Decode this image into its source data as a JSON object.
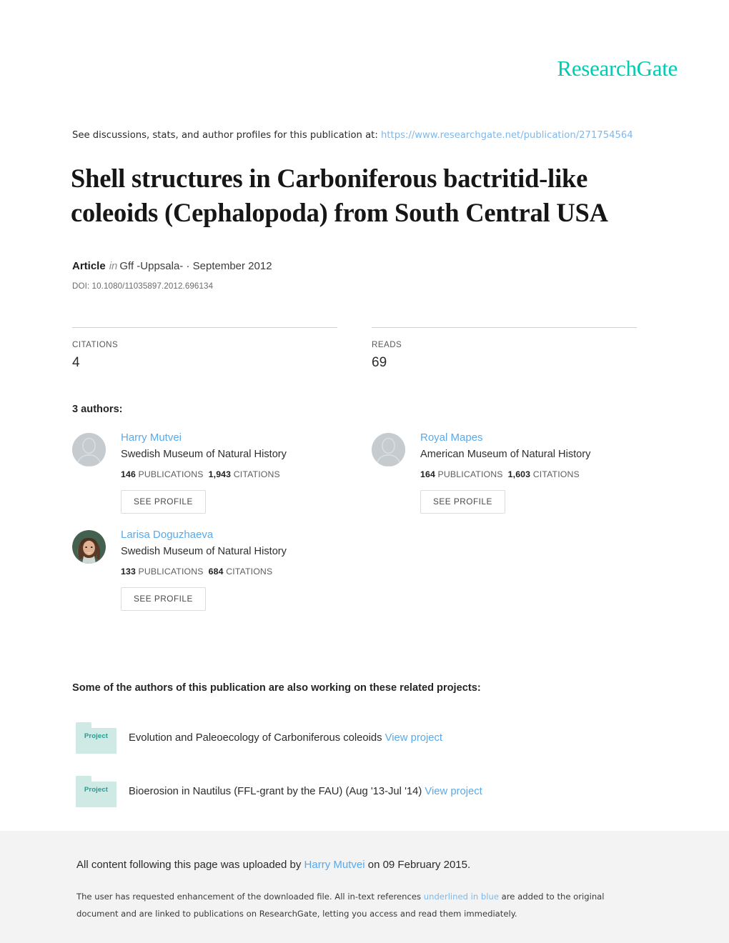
{
  "brand": {
    "logo_text": "ResearchGate",
    "logo_color": "#00ccb1"
  },
  "discussion": {
    "prefix": "See discussions, stats, and author profiles for this publication at: ",
    "url": "https://www.researchgate.net/publication/271754564",
    "link_color": "#7eb8ea"
  },
  "publication": {
    "title": "Shell structures in Carboniferous bactritid-like coleoids (Cephalopoda) from South Central USA",
    "type_label": "Article",
    "in_word": "in",
    "venue": "Gff -Uppsala- · September 2012",
    "doi": "DOI: 10.1080/11035897.2012.696134"
  },
  "stats": [
    {
      "label": "CITATIONS",
      "value": "4"
    },
    {
      "label": "READS",
      "value": "69"
    }
  ],
  "authors_section": {
    "heading": "3 authors:",
    "see_profile_label": "SEE PROFILE",
    "publications_word": "PUBLICATIONS",
    "citations_word": "CITATIONS",
    "authors": [
      {
        "name": "Harry Mutvei",
        "affiliation": "Swedish Museum of Natural History",
        "publications": "146",
        "citations": "1,943",
        "avatar_type": "placeholder-avatar"
      },
      {
        "name": "Royal Mapes",
        "affiliation": "American Museum of Natural History",
        "publications": "164",
        "citations": "1,603",
        "avatar_type": "placeholder-avatar"
      },
      {
        "name": "Larisa Doguzhaeva",
        "affiliation": "Swedish Museum of Natural History",
        "publications": "133",
        "citations": "684",
        "avatar_type": "photo-avatar"
      }
    ]
  },
  "projects_section": {
    "heading": "Some of the authors of this publication are also working on these related projects:",
    "folder_label": "Project",
    "view_label": "View project",
    "projects": [
      {
        "title": "Evolution and Paleoecology of Carboniferous coleoids"
      },
      {
        "title": "Bioerosion in Nautilus (FFL-grant by the FAU) (Aug '13-Jul '14)"
      }
    ]
  },
  "footer": {
    "upload_prefix": "All content following this page was uploaded by ",
    "uploader": "Harry Mutvei",
    "upload_suffix": " on 09 February 2015.",
    "note_part1": "The user has requested enhancement of the downloaded file. All in-text references ",
    "note_blue": "underlined in blue",
    "note_part2": " are added to the original document and are linked to publications on ResearchGate, letting you access and read them immediately."
  }
}
